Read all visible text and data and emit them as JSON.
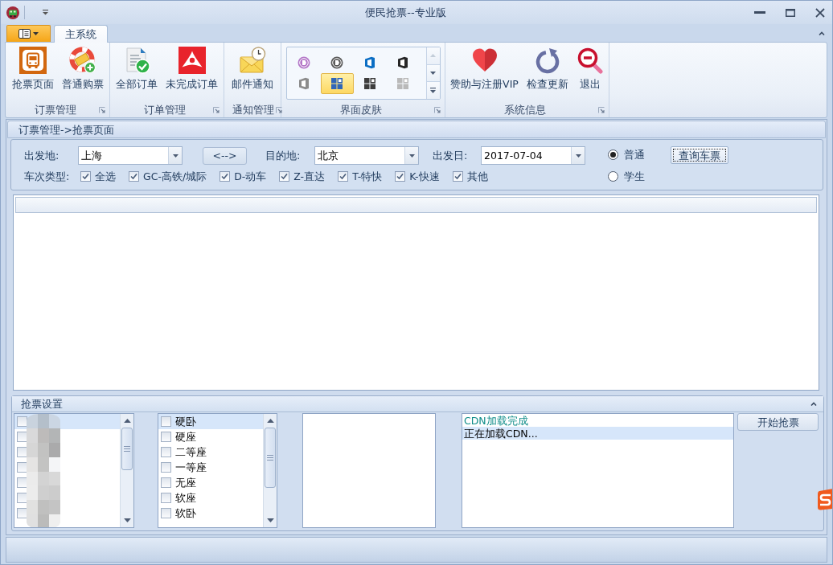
{
  "window": {
    "title": "便民抢票--专业版"
  },
  "ribbon": {
    "tabs": [
      {
        "label": "主系统",
        "selected": true
      }
    ],
    "groups": [
      {
        "label": "订票管理",
        "buttons": [
          "抢票页面",
          "普通购票"
        ]
      },
      {
        "label": "订单管理",
        "buttons": [
          "全部订单",
          "未完成订单"
        ]
      },
      {
        "label": "通知管理",
        "buttons": [
          "邮件通知"
        ]
      },
      {
        "label": "界面皮肤",
        "gallery": [
          {
            "kind": "disc",
            "color": "#b478c8",
            "selected": false
          },
          {
            "kind": "disc",
            "color": "#5a5a5a",
            "selected": false
          },
          {
            "kind": "office",
            "color": "#0b6ec4",
            "selected": false
          },
          {
            "kind": "office",
            "color": "#262626",
            "selected": false
          },
          {
            "kind": "office",
            "color": "#8c8c8c",
            "selected": false
          },
          {
            "kind": "tiles",
            "color": "#2f66b8",
            "selected": true
          },
          {
            "kind": "tiles",
            "color": "#3d3d3d",
            "selected": false
          },
          {
            "kind": "tiles",
            "color": "#b9b9b9",
            "selected": false
          }
        ]
      },
      {
        "label": "系统信息",
        "buttons": [
          "赞助与注册VIP",
          "检查更新",
          "退出"
        ]
      }
    ]
  },
  "page": {
    "breadcrumb": "订票管理->抢票页面",
    "search_form": {
      "from": {
        "label": "出发地:",
        "value": "上海"
      },
      "swap_button": "<-->",
      "to": {
        "label": "目的地:",
        "value": "北京"
      },
      "date": {
        "label": "出发日:",
        "value": "2017-07-04"
      },
      "ticket_type": [
        {
          "label": "普通",
          "selected": true
        },
        {
          "label": "学生",
          "selected": false
        }
      ],
      "query_button": {
        "label": "查询车票",
        "focused": true
      },
      "train_types_label": "车次类型:",
      "train_types": [
        {
          "label": "全选",
          "checked": true
        },
        {
          "label": "GC-高铁/城际",
          "checked": true
        },
        {
          "label": "D-动车",
          "checked": true
        },
        {
          "label": "Z-直达",
          "checked": true
        },
        {
          "label": "T-特快",
          "checked": true
        },
        {
          "label": "K-快速",
          "checked": true
        },
        {
          "label": "其他",
          "checked": true
        }
      ]
    },
    "settings": {
      "title": "抢票设置",
      "expanded": true,
      "passengers": [
        {
          "checked": false,
          "selected": true
        },
        {
          "checked": false,
          "selected": false
        },
        {
          "checked": false,
          "selected": false
        },
        {
          "checked": false,
          "selected": false
        },
        {
          "checked": false,
          "selected": false
        },
        {
          "checked": false,
          "selected": false
        },
        {
          "checked": false,
          "selected": false
        }
      ],
      "seats": [
        {
          "label": "硬卧",
          "checked": false,
          "selected": true
        },
        {
          "label": "硬座",
          "checked": false,
          "selected": false
        },
        {
          "label": "二等座",
          "checked": false,
          "selected": false
        },
        {
          "label": "一等座",
          "checked": false,
          "selected": false
        },
        {
          "label": "无座",
          "checked": false,
          "selected": false
        },
        {
          "label": "软座",
          "checked": false,
          "selected": false
        },
        {
          "label": "软卧",
          "checked": false,
          "selected": false
        }
      ],
      "log": [
        {
          "text": "CDN加载完成",
          "color": "#0e8c88",
          "selected": false
        },
        {
          "text": "正在加载CDN...",
          "color": "#000000",
          "selected": true
        }
      ],
      "start_button": "开始抢票"
    }
  }
}
